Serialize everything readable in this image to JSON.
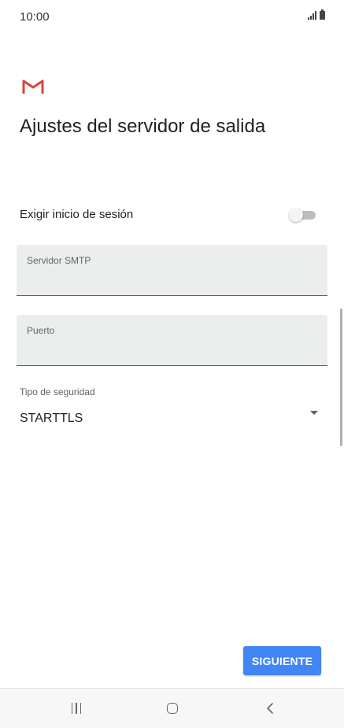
{
  "status_bar": {
    "time": "10:00"
  },
  "page": {
    "title": "Ajustes del servidor de salida"
  },
  "login_toggle": {
    "label": "Exigir inicio de sesión",
    "checked": false
  },
  "smtp_server": {
    "label": "Servidor SMTP",
    "value": ""
  },
  "port": {
    "label": "Puerto",
    "value": ""
  },
  "security_type": {
    "label": "Tipo de seguridad",
    "value": "STARTTLS"
  },
  "next_button": {
    "label": "SIGUIENTE"
  },
  "colors": {
    "accent": "#4285f4",
    "gmail_red": "#db4437",
    "field_bg": "#eceeee"
  },
  "icons": {
    "logo": "gmail-logo",
    "dropdown": "dropdown-arrow-icon",
    "recent": "recent-apps-icon",
    "home": "home-icon",
    "back": "back-icon"
  }
}
